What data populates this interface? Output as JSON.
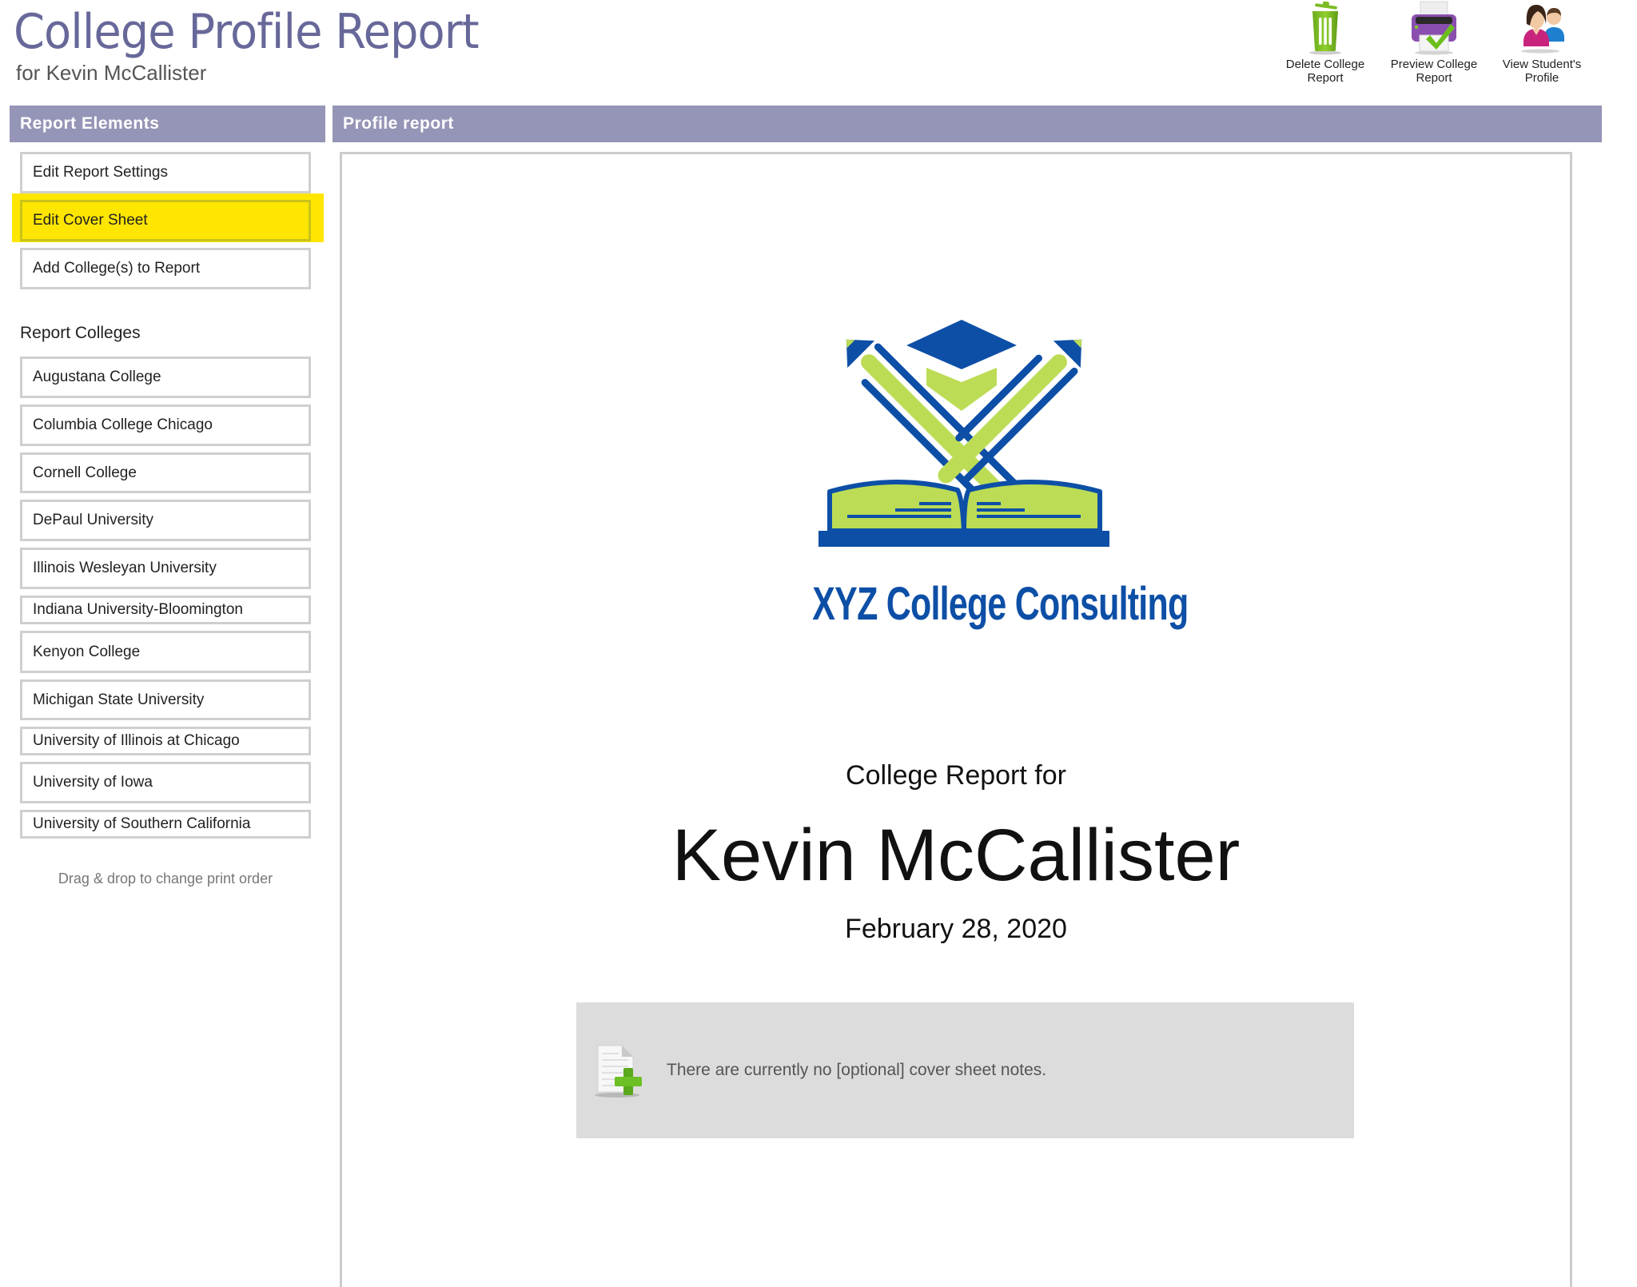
{
  "header": {
    "title": "College Profile Report",
    "subtitle": "for Kevin McCallister"
  },
  "actions": [
    {
      "label": "Delete College Report",
      "icon": "trash-icon"
    },
    {
      "label": "Preview College Report",
      "icon": "printer-check-icon"
    },
    {
      "label": "View Student's Profile",
      "icon": "users-icon"
    }
  ],
  "sidebar": {
    "header": "Report Elements",
    "elements": [
      {
        "label": "Edit Report Settings",
        "highlighted": false
      },
      {
        "label": "Edit Cover Sheet",
        "highlighted": true
      },
      {
        "label": "Add College(s) to Report",
        "highlighted": false
      }
    ],
    "colleges_heading": "Report Colleges",
    "colleges": [
      "Augustana College",
      "Columbia College Chicago",
      "Cornell College",
      "DePaul University",
      "Illinois Wesleyan University",
      "Indiana University-Bloomington",
      "Kenyon College",
      "Michigan State University",
      "University of Illinois at Chicago",
      "University of Iowa",
      "University of Southern California"
    ],
    "drag_hint": "Drag & drop to change print order"
  },
  "main": {
    "header": "Profile report",
    "logo_text": "XYZ College Consulting",
    "cover_for": "College Report for",
    "student_name": "Kevin McCallister",
    "date": "February 28, 2020",
    "notes_text": "There are currently no [optional] cover sheet notes.",
    "notes_icon": "add-document-icon"
  },
  "colors": {
    "title": "#676899",
    "section_header": "#9595b7",
    "highlight": "#ffe600",
    "logo_blue": "#0d4fa6",
    "logo_green": "#bcdc56",
    "notes_bg": "#dcdcdc"
  }
}
